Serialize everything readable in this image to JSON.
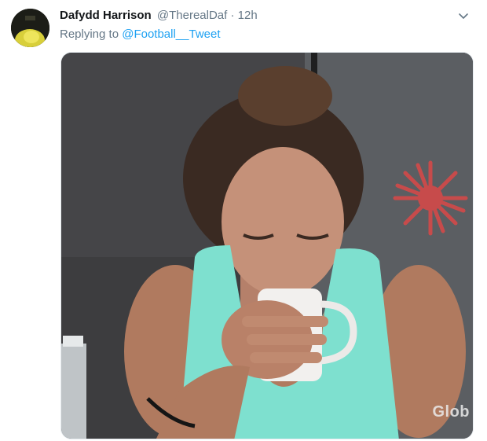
{
  "tweet": {
    "display_name": "Dafydd Harrison",
    "handle": "@TherealDaf",
    "separator": "·",
    "timestamp": "12h",
    "reply_prefix": "Replying to",
    "reply_to": "@Football__Tweet",
    "menu_icon": "chevron-down-icon",
    "media": {
      "type": "gif",
      "watermark": "Glob"
    }
  },
  "colors": {
    "link": "#1da1f2",
    "secondary_text": "#657786",
    "primary_text": "#14171a",
    "top_color": "#7ee0cf"
  }
}
